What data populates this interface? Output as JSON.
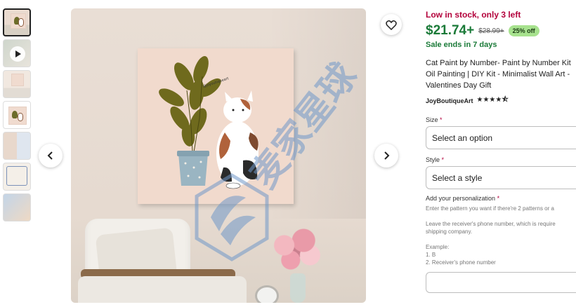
{
  "listing": {
    "stock_status": "Low in stock, only 3 left",
    "price": "$21.74+",
    "original_price": "$28.99+",
    "discount_badge": "25% off",
    "sale_note": "Sale ends in 7 days",
    "title_lines": [
      "Cat Paint by Number- Paint by Number Kit",
      "Oil Painting | DIY Kit - Minimalist Wall Art -",
      "Valentines Day Gift"
    ],
    "shop_name": "JoyBoutiqueArt",
    "rating_stars": "★★★★⯪",
    "rating_value": 4.5
  },
  "gallery": {
    "canvas_signature": "@joyoutiqueart",
    "watermark_text": "麦家星球"
  },
  "options": {
    "size": {
      "label": "Size",
      "required_mark": "*",
      "value": "Select an option"
    },
    "style": {
      "label": "Style",
      "required_mark": "*",
      "value": "Select a style"
    },
    "personalization": {
      "label": "Add your personalization",
      "required_mark": "*",
      "hint_lines": [
        "Enter the pattern you want if there're 2 patterns or a",
        "",
        "Leave the receiver's phone number, which is require",
        "shipping company.",
        "",
        "Example:",
        "1. B",
        "2. Receiver's phone number"
      ]
    }
  },
  "icons": {
    "prev": "chevron-left-icon",
    "next": "chevron-right-icon",
    "favorite": "heart-icon",
    "play": "play-icon"
  }
}
